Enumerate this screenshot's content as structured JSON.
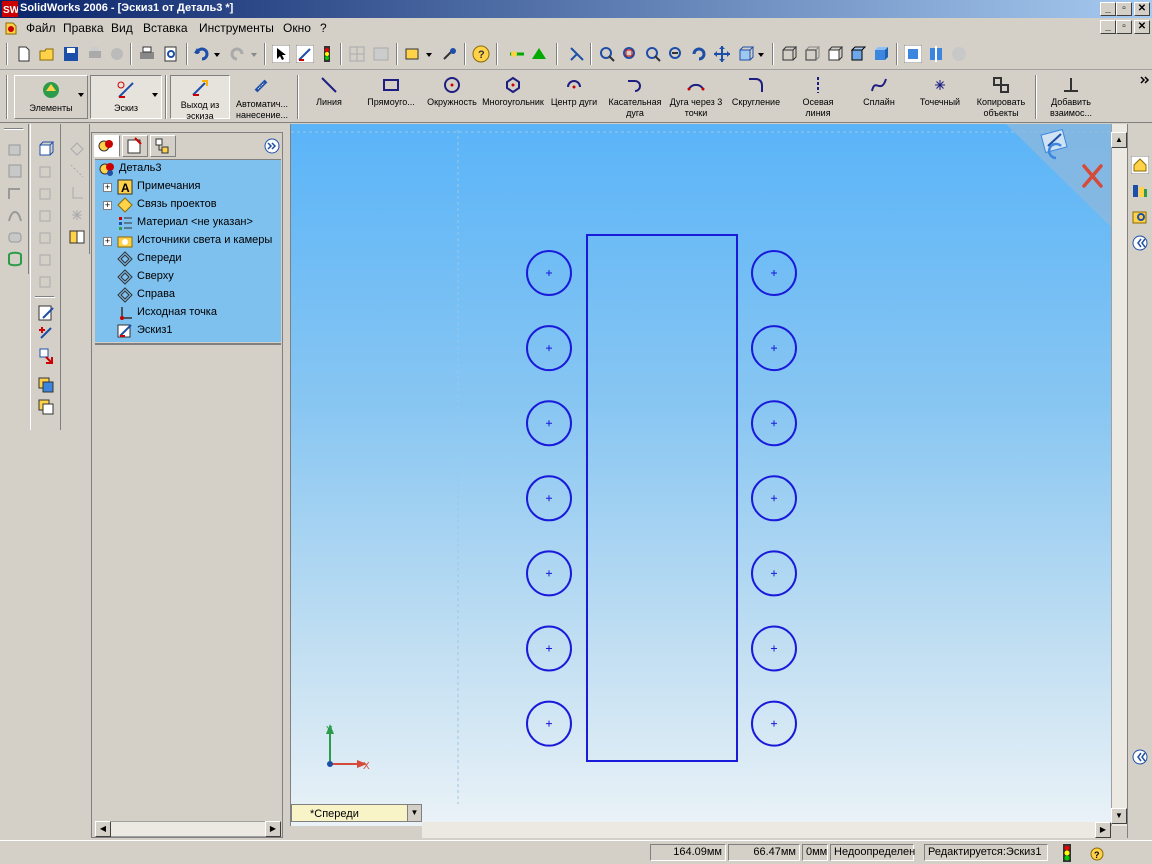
{
  "window": {
    "title": "SolidWorks 2006 - [Эскиз1 от Деталь3 *]",
    "controls": [
      "_",
      "▫",
      "✕"
    ]
  },
  "menu": {
    "items": [
      "Файл",
      "Правка",
      "Вид",
      "Вставка",
      "Инструменты",
      "Окно",
      "?"
    ]
  },
  "command_manager": {
    "elements_label": "Элементы",
    "sketch_label": "Эскиз",
    "exit_sketch_label": "Выход из эскиза",
    "smart_dim_label": "Автоматич... нанесение...",
    "tools": [
      {
        "id": "line",
        "label": "Линия",
        "icon": "line-icon"
      },
      {
        "id": "rectangle",
        "label": "Прямоуго...",
        "icon": "rectangle-icon"
      },
      {
        "id": "circle",
        "label": "Окружность",
        "icon": "circle-icon"
      },
      {
        "id": "polygon",
        "label": "Многоугольник",
        "icon": "polygon-icon"
      },
      {
        "id": "centerpoint-arc",
        "label": "Центр дуги",
        "icon": "centerpoint-arc-icon"
      },
      {
        "id": "tangent-arc",
        "label": "Касательная дуга",
        "icon": "tangent-arc-icon"
      },
      {
        "id": "three-point-arc",
        "label": "Дуга через 3 точки",
        "icon": "three-point-arc-icon"
      },
      {
        "id": "fillet",
        "label": "Скругление",
        "icon": "fillet-icon"
      },
      {
        "id": "centerline",
        "label": "Осевая линия",
        "icon": "centerline-icon"
      },
      {
        "id": "spline",
        "label": "Сплайн",
        "icon": "spline-icon"
      },
      {
        "id": "point",
        "label": "Точечный",
        "icon": "point-icon"
      },
      {
        "id": "copy-entities",
        "label": "Копировать объекты",
        "icon": "copy-entities-icon"
      },
      {
        "id": "add-relation",
        "label": "Добавить взаимос...",
        "icon": "add-relation-icon"
      }
    ]
  },
  "feature_manager": {
    "tree": [
      {
        "label": "Деталь3",
        "icon": "part-icon",
        "expandable": false,
        "level": 0
      },
      {
        "label": "Примечания",
        "icon": "annotations-icon",
        "expandable": true,
        "level": 1
      },
      {
        "label": "Связь проектов",
        "icon": "design-binder-icon",
        "expandable": true,
        "level": 1
      },
      {
        "label": "Материал <не указан>",
        "icon": "material-icon",
        "expandable": false,
        "level": 1
      },
      {
        "label": "Источники света и камеры",
        "icon": "lights-icon",
        "expandable": true,
        "level": 1
      },
      {
        "label": "Спереди",
        "icon": "plane-icon",
        "expandable": false,
        "level": 1
      },
      {
        "label": "Сверху",
        "icon": "plane-icon",
        "expandable": false,
        "level": 1
      },
      {
        "label": "Справа",
        "icon": "plane-icon",
        "expandable": false,
        "level": 1
      },
      {
        "label": "Исходная точка",
        "icon": "origin-icon",
        "expandable": false,
        "level": 1
      },
      {
        "label": "Эскиз1",
        "icon": "sketch-icon",
        "expandable": false,
        "level": 1
      }
    ]
  },
  "viewport": {
    "view_name": "*Спереди",
    "axis_x": "X",
    "axis_y": "Y",
    "sketch_color": "#1a1adb",
    "circle_rows": 7
  },
  "status": {
    "x_coord": "164.09мм",
    "y_coord": "66.47мм",
    "z_coord": "0мм",
    "definition": "Недоопределен",
    "editing": "Редактируется:Эскиз1"
  }
}
